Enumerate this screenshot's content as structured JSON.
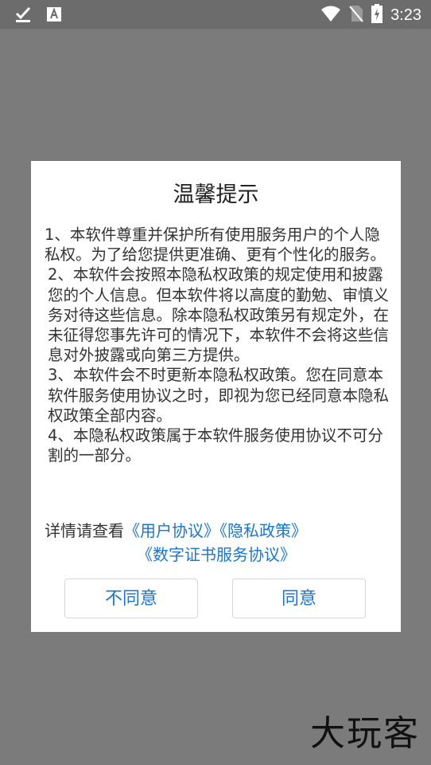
{
  "status_bar": {
    "time": "3:23",
    "icons": [
      "download-done-icon",
      "app-notification-icon",
      "wifi-icon",
      "no-sim-icon",
      "battery-charging-icon"
    ]
  },
  "dialog": {
    "title": "温馨提示",
    "paragraphs": [
      "1、本软件尊重并保护所有使用服务用户的个人隐私权。为了给您提供更准确、更有个性化的服务。",
      "2、本软件会按照本隐私权政策的规定使用和披露您的个人信息。但本软件将以高度的勤勉、审慎义务对待这些信息。除本隐私权政策另有规定外，在未征得您事先许可的情况下，本软件不会将这些信息对外披露或向第三方提供。",
      "3、本软件会不时更新本隐私权政策。您在同意本软件服务使用协议之时，即视为您已经同意本隐私权政策全部内容。",
      "4、本隐私权政策属于本软件服务使用协议不可分割的一部分。"
    ],
    "details_prefix": "详情请查看",
    "link_user_agreement": "《用户协议》",
    "link_privacy_policy": "《隐私政策》",
    "link_certificate": "《数字证书服务协议》",
    "disagree_label": "不同意",
    "agree_label": "同意"
  },
  "watermark": "大玩客",
  "colors": {
    "overlay": "#7b7b7b",
    "link": "#1976d2",
    "dialog_bg": "#ffffff"
  }
}
